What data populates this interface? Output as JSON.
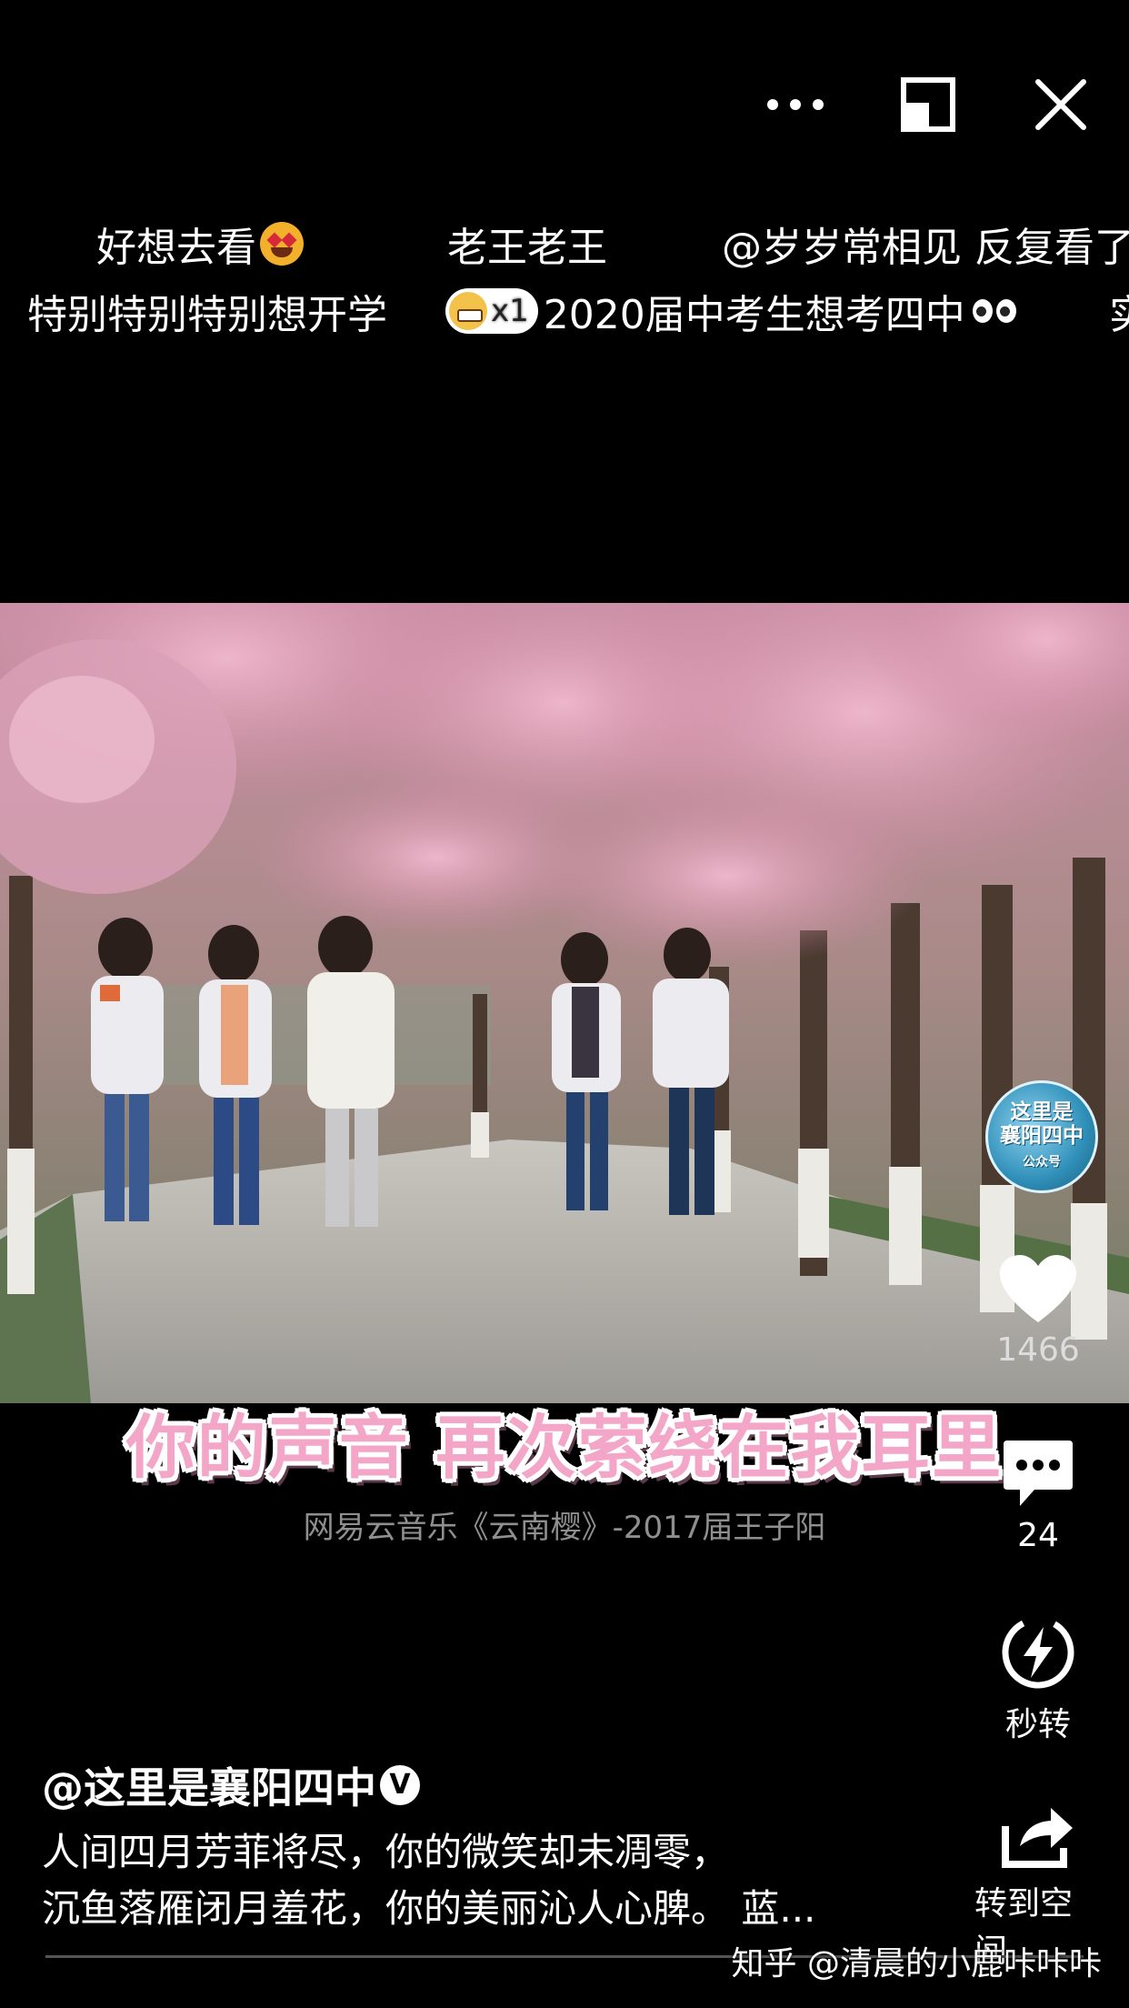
{
  "controls": {
    "more": "more-icon",
    "minimize": "pip-icon",
    "close": "close-icon"
  },
  "danmaku": {
    "row1": [
      "好想去看",
      "老王老王",
      "@岁岁常相见 反复看了"
    ],
    "row2_a": "特别特别特别想开学",
    "row2_combo": "x1",
    "row2_b": "2020届中考生想考四中",
    "row2_c": "实"
  },
  "video": {
    "caption_big": "你的声音 再次萦绕在我耳里",
    "caption_small": "网易云音乐《云南樱》-2017届王子阳"
  },
  "rail": {
    "avatar_text": [
      "这里是",
      "襄阳四中",
      "公众号"
    ],
    "likes": "1466",
    "comments": "24",
    "quick_share": "秒转",
    "share_space": "转到空间"
  },
  "post": {
    "author": "@这里是襄阳四中",
    "verified": "V",
    "line1": "人间四月芳菲将尽，你的微笑却未凋零，",
    "line2": "沉鱼落雁闭月羞花，你的美丽沁人心脾。 蓝..."
  },
  "watermark": "知乎 @清晨的小鹿咔咔咔",
  "colors": {
    "background": "#000000",
    "caption_pink": "#f3a6c7",
    "caption_small": "#8f8f8f"
  }
}
